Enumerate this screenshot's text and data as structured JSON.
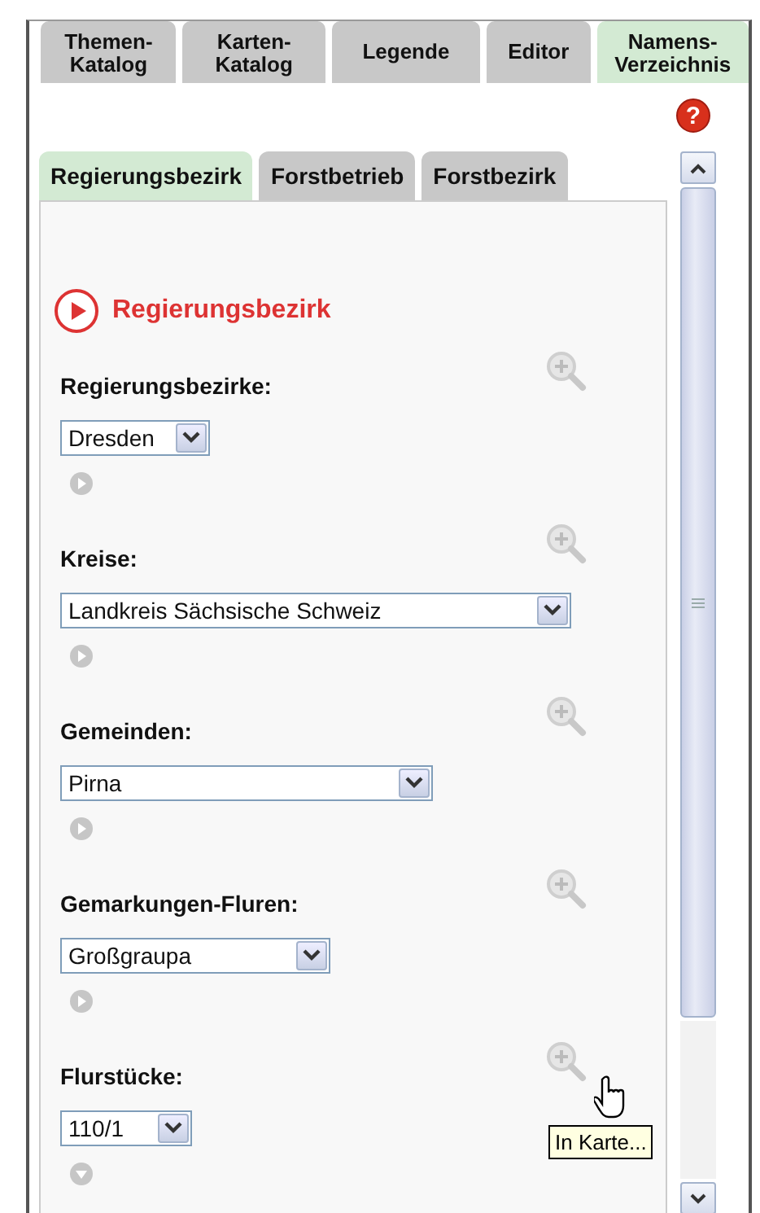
{
  "top_tabs": [
    {
      "label": "Themen-\nKatalog",
      "selected": false
    },
    {
      "label": "Karten-\nKatalog",
      "selected": false
    },
    {
      "label": "Legende",
      "selected": false
    },
    {
      "label": "Editor",
      "selected": false
    },
    {
      "label": "Namens-\nVerzeichnis",
      "selected": true
    }
  ],
  "help": {
    "symbol": "?"
  },
  "sub_tabs": [
    {
      "label": "Regierungsbezirk",
      "selected": true
    },
    {
      "label": "Forstbetrieb",
      "selected": false
    },
    {
      "label": "Forstbezirk",
      "selected": false
    }
  ],
  "heading": "Regierungsbezirk",
  "sections": [
    {
      "label": "Regierungsbezirke:",
      "value": "Dresden",
      "expanded": false
    },
    {
      "label": "Kreise:",
      "value": "Landkreis Sächsische Schweiz",
      "expanded": false
    },
    {
      "label": "Gemeinden:",
      "value": "Pirna",
      "expanded": false
    },
    {
      "label": "Gemarkungen-Fluren:",
      "value": "Großgraupa",
      "expanded": false
    },
    {
      "label": "Flurstücke:",
      "value": "110/1",
      "expanded": true
    }
  ],
  "tooltip": "In Karte..."
}
